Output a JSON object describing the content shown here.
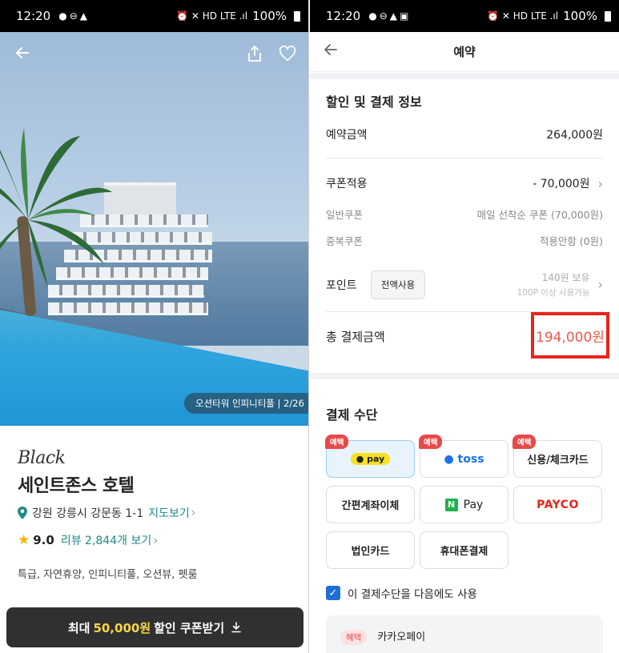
{
  "left": {
    "status": {
      "time": "12:20",
      "battery": "100%",
      "left_icons": "●⊖▲",
      "right_icons": "⏰ ✕ HD LTE .ıl"
    },
    "photo_caption": "오션타워 인피니티풀 | 2/26",
    "brand": "Black",
    "hotel_name": "세인트존스 호텔",
    "address": "강원 강릉시 강문동 1-1",
    "map_link": "지도보기",
    "rating": "9.0",
    "review_link": "리뷰 2,844개 보기",
    "tags": "특급, 자연휴양, 인피니티풀, 오션뷰, 펫룸",
    "coupon": {
      "prefix": "최대",
      "amount": "50,000원",
      "suffix": "할인 쿠폰받기"
    }
  },
  "right": {
    "status": {
      "time": "12:20",
      "battery": "100%",
      "left_icons": "●⊖▲▣",
      "right_icons": "⏰ ✕ HD LTE .ıl"
    },
    "header_title": "예약",
    "discount_section_title": "할인 및 결제 정보",
    "booking_amount_label": "예약금액",
    "booking_amount": "264,000원",
    "coupon_label": "쿠폰적용",
    "coupon_value": "- 70,000원",
    "general_coupon_label": "일반쿠폰",
    "general_coupon_value": "매일 선착순 쿠폰 (70,000원)",
    "dup_coupon_label": "중복쿠폰",
    "dup_coupon_value": "적용안함 (0원)",
    "point_label": "포인트",
    "point_button": "전액사용",
    "point_hold": "140원 보유",
    "point_min": "100P 이상 사용가능",
    "total_label": "총 결제금액",
    "total_amount": "194,000원",
    "payment_section_title": "결제 수단",
    "pay_methods": {
      "badge": "예택",
      "kakaopay": "pay",
      "toss": "toss",
      "card": "신용/체크카드",
      "bank": "간편계좌이체",
      "npay_n": "N",
      "npay": "Pay",
      "payco": "PAYCO",
      "corp": "법인카드",
      "phone": "휴대폰결제"
    },
    "remember_method": "이 결제수단을 다음에도 사용",
    "benefit_tag": "혜택",
    "benefit_name": "카카오페이"
  },
  "colors": {
    "accent_teal": "#1f8a8a",
    "highlight_red": "#e8251b",
    "coupon_yellow": "#f7d54a"
  }
}
